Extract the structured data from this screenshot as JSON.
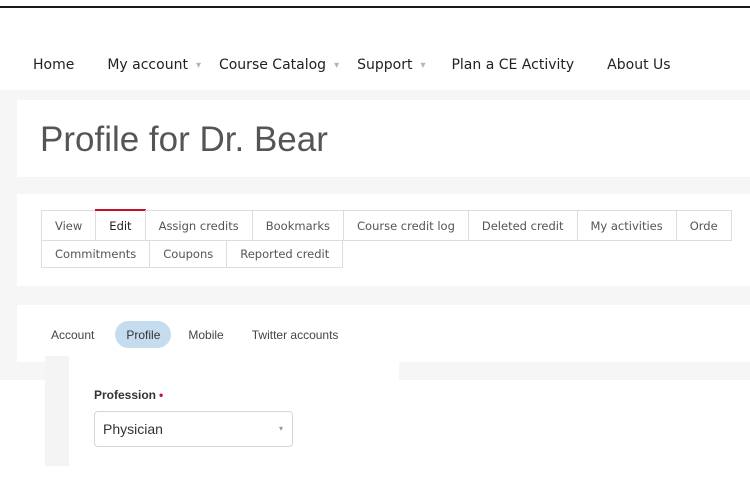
{
  "nav": {
    "items": [
      {
        "label": "Home",
        "caret": false
      },
      {
        "label": "My account",
        "caret": true
      },
      {
        "label": "Course Catalog",
        "caret": true
      },
      {
        "label": "Support",
        "caret": true
      },
      {
        "label": "Plan a CE Activity",
        "caret": false
      },
      {
        "label": "About Us",
        "caret": false
      }
    ],
    "caret_glyph": "▾"
  },
  "page": {
    "title": "Profile for Dr. Bear"
  },
  "tabs": {
    "row1": [
      "View",
      "Edit",
      "Assign credits",
      "Bookmarks",
      "Course credit log",
      "Deleted credit",
      "My activities",
      "Orde"
    ],
    "row2": [
      "Commitments",
      "Coupons",
      "Reported credit"
    ],
    "active": "Edit"
  },
  "subtabs": {
    "items": [
      "Account",
      "Profile",
      "Mobile",
      "Twitter accounts"
    ],
    "active": "Profile"
  },
  "form": {
    "profession": {
      "label": "Profession",
      "required_mark": "•",
      "value": "Physician"
    }
  },
  "colors": {
    "accent_red": "#c8102e",
    "active_pill": "#c5dcef",
    "band_grey": "#f6f6f6"
  }
}
